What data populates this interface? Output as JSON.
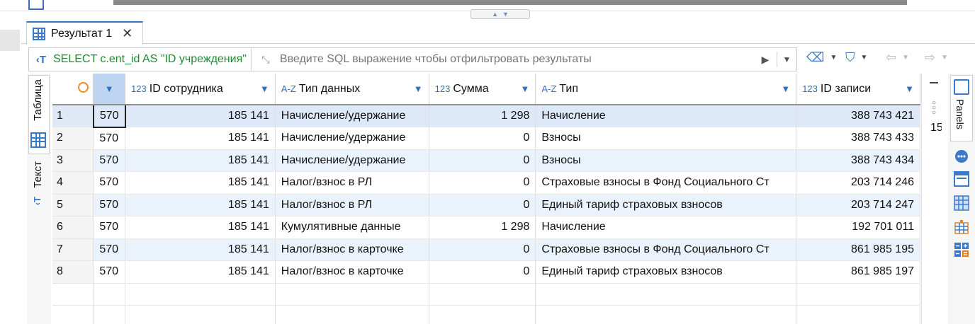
{
  "result_tab": {
    "label": "Результат 1"
  },
  "filter": {
    "query": "SELECT c.ent_id AS \"ID учреждения\"",
    "placeholder": "Введите SQL выражение чтобы отфильтровать результаты"
  },
  "left_tabs": {
    "table": "Таблица",
    "text": "Текст"
  },
  "right_panel": {
    "label": "Panels",
    "partial_number": "15"
  },
  "columns": [
    {
      "type": "",
      "label": ""
    },
    {
      "type": "123",
      "label": "ID сотрудника"
    },
    {
      "type": "A-Z",
      "label": "Тип данных"
    },
    {
      "type": "123",
      "label": "Сумма"
    },
    {
      "type": "A-Z",
      "label": "Тип"
    },
    {
      "type": "123",
      "label": "ID записи"
    }
  ],
  "rows": [
    {
      "n": "1",
      "c0": "570",
      "c1": "185 141",
      "c2": "Начисление/удержание",
      "c3": "1 298",
      "c4": "Начисление",
      "c5": "388 743 421"
    },
    {
      "n": "2",
      "c0": "570",
      "c1": "185 141",
      "c2": "Начисление/удержание",
      "c3": "0",
      "c4": "Взносы",
      "c5": "388 743 433"
    },
    {
      "n": "3",
      "c0": "570",
      "c1": "185 141",
      "c2": "Начисление/удержание",
      "c3": "0",
      "c4": "Взносы",
      "c5": "388 743 434"
    },
    {
      "n": "4",
      "c0": "570",
      "c1": "185 141",
      "c2": "Налог/взнос в РЛ",
      "c3": "0",
      "c4": "Страховые взносы в Фонд Социального Ст",
      "c5": "203 714 246"
    },
    {
      "n": "5",
      "c0": "570",
      "c1": "185 141",
      "c2": "Налог/взнос в РЛ",
      "c3": "0",
      "c4": "Единый тариф страховых взносов",
      "c5": "203 714 247"
    },
    {
      "n": "6",
      "c0": "570",
      "c1": "185 141",
      "c2": "Кумулятивные данные",
      "c3": "1 298",
      "c4": "Начисление",
      "c5": "192 701 011"
    },
    {
      "n": "7",
      "c0": "570",
      "c1": "185 141",
      "c2": "Налог/взнос в карточке",
      "c3": "0",
      "c4": "Страховые взносы в Фонд Социального Ст",
      "c5": "861 985 195"
    },
    {
      "n": "8",
      "c0": "570",
      "c1": "185 141",
      "c2": "Налог/взнос в карточке",
      "c3": "0",
      "c4": "Единый тариф страховых взносов",
      "c5": "861 985 197"
    }
  ],
  "colors": {
    "accent": "#3b79c9",
    "row_alt": "#eaf2fc",
    "sql_green": "#1e8a2e",
    "orange": "#f08c1a"
  }
}
